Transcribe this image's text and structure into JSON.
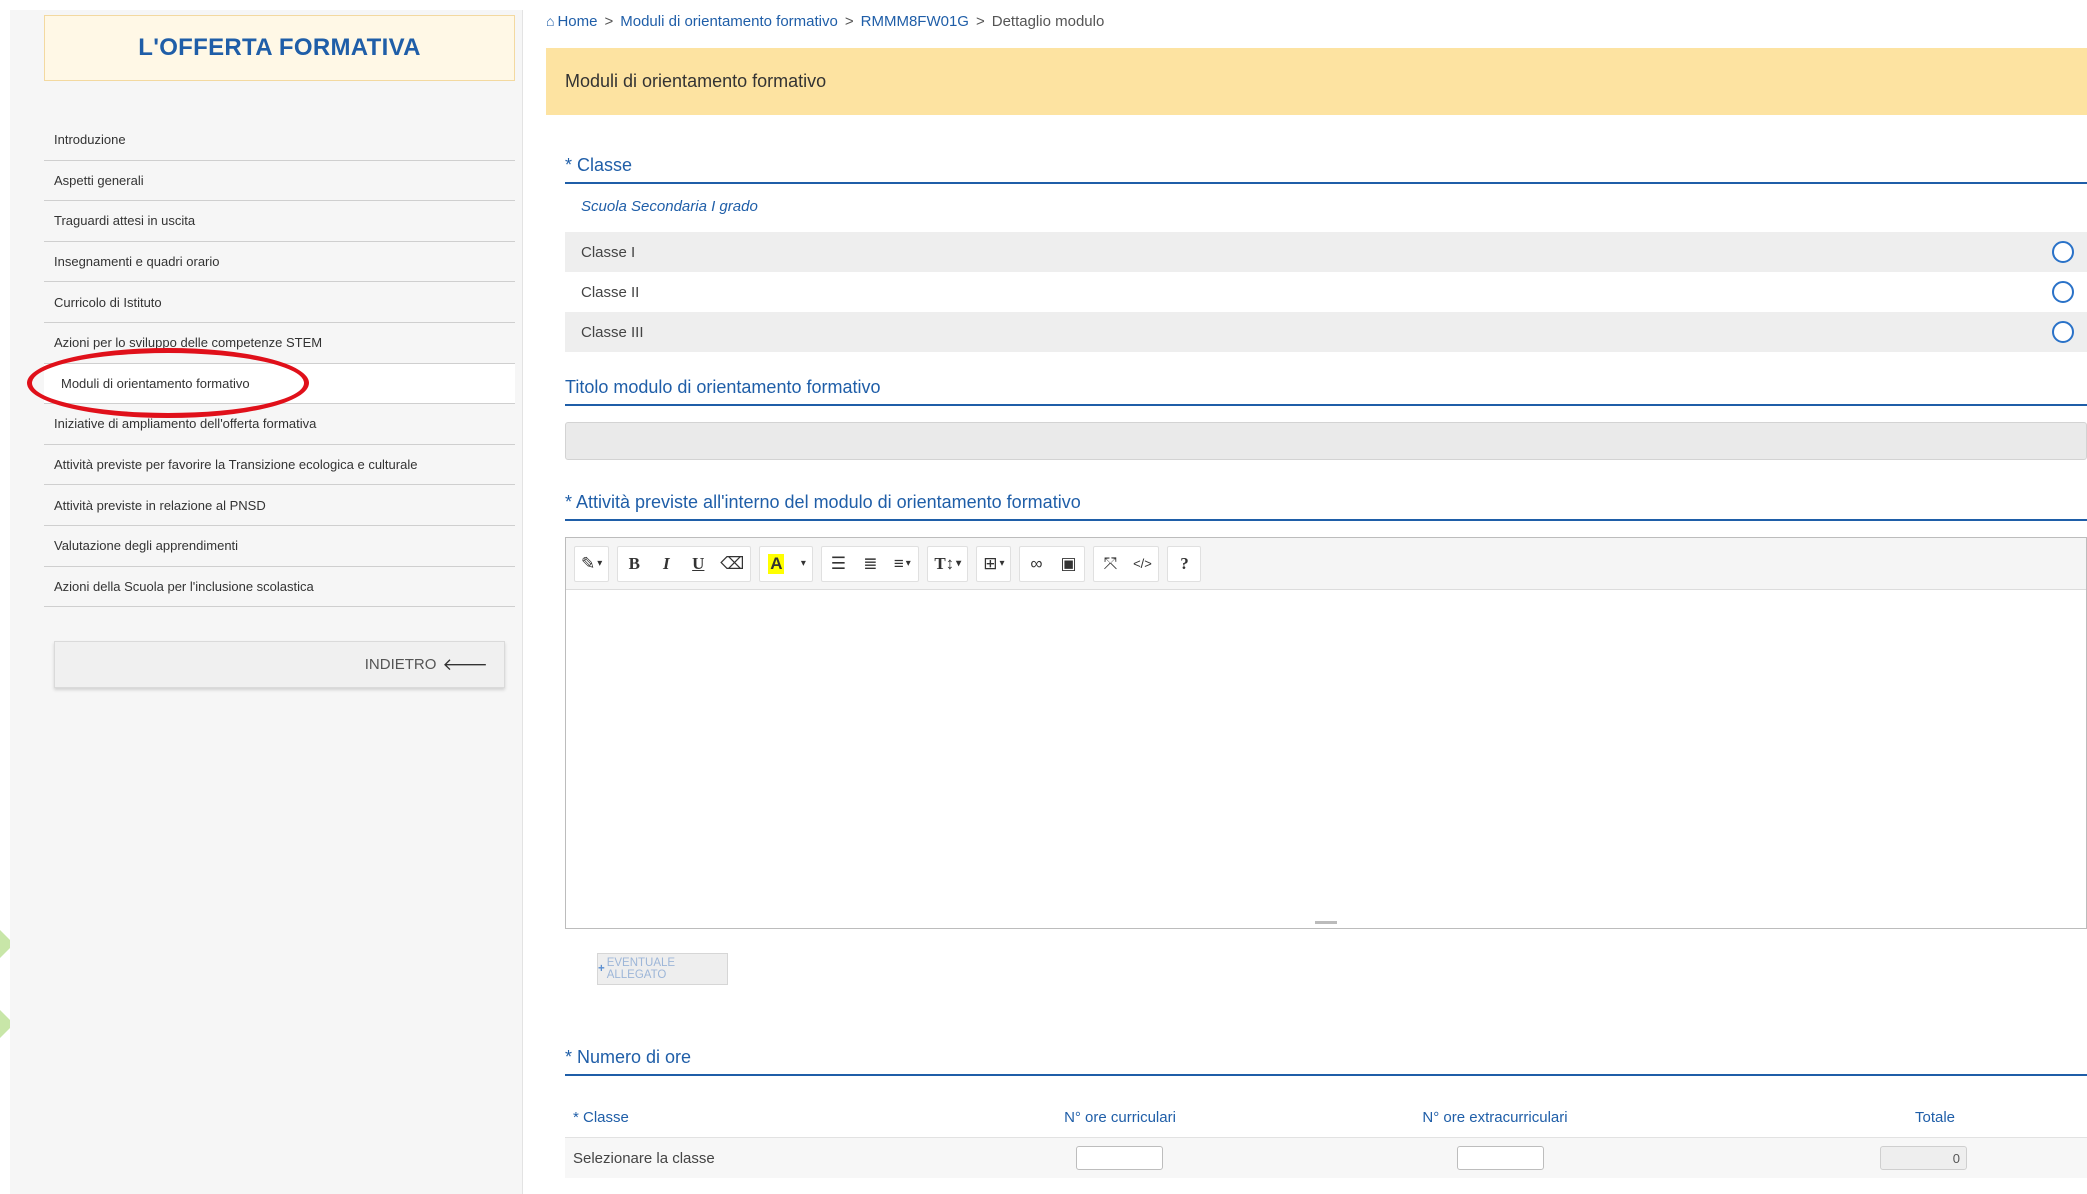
{
  "sidebar": {
    "title": "L'OFFERTA FORMATIVA",
    "items": [
      {
        "label": "Introduzione"
      },
      {
        "label": "Aspetti generali"
      },
      {
        "label": "Traguardi attesi in uscita"
      },
      {
        "label": "Insegnamenti e quadri orario"
      },
      {
        "label": "Curricolo di Istituto"
      },
      {
        "label": "Azioni per lo sviluppo delle competenze STEM"
      },
      {
        "label": "Moduli di orientamento formativo"
      },
      {
        "label": "Iniziative di ampliamento dell'offerta formativa"
      },
      {
        "label": "Attività previste per favorire la Transizione ecologica e culturale"
      },
      {
        "label": "Attività previste in relazione al PNSD"
      },
      {
        "label": "Valutazione degli apprendimenti"
      },
      {
        "label": "Azioni della Scuola per l'inclusione scolastica"
      }
    ],
    "back_label": "INDIETRO",
    "back_icon": "arrow-left-icon"
  },
  "breadcrumb": {
    "home": "Home",
    "item1": "Moduli di orientamento formativo",
    "item2": "RMMM8FW01G",
    "current": "Dettaglio modulo",
    "separator": ">"
  },
  "panel": {
    "title": "Moduli di orientamento formativo"
  },
  "classe": {
    "title": "* Classe",
    "school_level": "Scuola Secondaria I grado",
    "options": [
      {
        "label": "Classe I"
      },
      {
        "label": "Classe II"
      },
      {
        "label": "Classe III"
      }
    ]
  },
  "titolo": {
    "title": "Titolo modulo di orientamento formativo",
    "value": ""
  },
  "attivita": {
    "title": "* Attività previste all'interno del modulo di orientamento formativo",
    "toolbar": {
      "style": "✎",
      "bold": "B",
      "italic": "I",
      "underline": "U",
      "eraser": "⌫",
      "color": "A",
      "ul": "☰",
      "ol": "≣",
      "align": "≡",
      "font_size": "T↕",
      "table": "⊞",
      "link": "∞",
      "image": "▣",
      "fullscreen": "⤧",
      "code": "</>",
      "help": "?"
    },
    "attach_label": "EVENTUALE ALLEGATO"
  },
  "ore": {
    "title": "* Numero di ore",
    "headers": {
      "classe": "* Classe",
      "curricolari": "N° ore curriculari",
      "extracurricolari": "N° ore extracurriculari",
      "totale": "Totale"
    },
    "row": {
      "classe": "Selezionare la classe",
      "curricolari": "",
      "extracurricolari": "",
      "totale": "0"
    }
  },
  "colors": {
    "accent": "#1f5ea8",
    "header_bg": "#fde3a1",
    "highlight_oval": "#e0101a"
  }
}
